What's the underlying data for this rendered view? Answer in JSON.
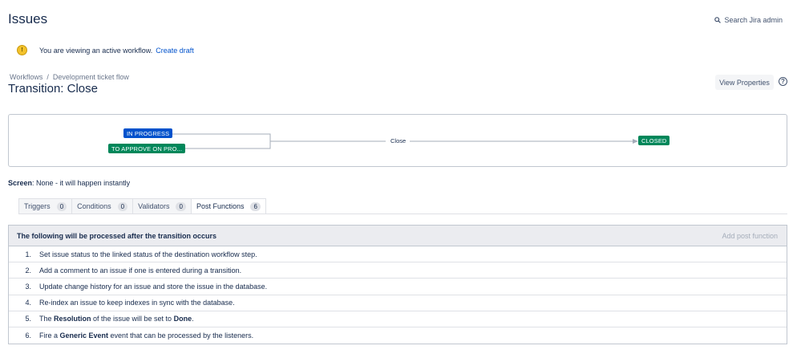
{
  "header": {
    "title": "Issues",
    "search_admin": "Search Jira admin"
  },
  "notice": {
    "text": "You are viewing an active workflow.",
    "link": "Create draft"
  },
  "breadcrumb": {
    "items": [
      "Workflows",
      "Development ticket flow"
    ],
    "separator": "/"
  },
  "transition": {
    "title": "Transition: Close",
    "view_properties": "View Properties"
  },
  "diagram": {
    "from_statuses": [
      "IN PROGRESS",
      "TO APPROVE ON PRO..."
    ],
    "transition_label": "Close",
    "to_status": "CLOSED",
    "colors": {
      "in_progress": "#0052cc",
      "done": "#00875a"
    }
  },
  "screen": {
    "label": "Screen",
    "value": ": None - it will happen instantly"
  },
  "tabs": [
    {
      "label": "Triggers",
      "count": "0"
    },
    {
      "label": "Conditions",
      "count": "0"
    },
    {
      "label": "Validators",
      "count": "0"
    },
    {
      "label": "Post Functions",
      "count": "6"
    }
  ],
  "post_functions": {
    "header": "The following will be processed after the transition occurs",
    "add_label": "Add post function",
    "items": [
      {
        "num": "1.",
        "pre": "Set issue status to the linked status of the destination workflow step.",
        "bold1": "",
        "mid": "",
        "bold2": "",
        "post": ""
      },
      {
        "num": "2.",
        "pre": "Add a comment to an issue if one is entered during a transition.",
        "bold1": "",
        "mid": "",
        "bold2": "",
        "post": ""
      },
      {
        "num": "3.",
        "pre": "Update change history for an issue and store the issue in the database.",
        "bold1": "",
        "mid": "",
        "bold2": "",
        "post": ""
      },
      {
        "num": "4.",
        "pre": "Re-index an issue to keep indexes in sync with the database.",
        "bold1": "",
        "mid": "",
        "bold2": "",
        "post": ""
      },
      {
        "num": "5.",
        "pre": "The ",
        "bold1": "Resolution",
        "mid": " of the issue will be set to ",
        "bold2": "Done",
        "post": "."
      },
      {
        "num": "6.",
        "pre": "Fire a ",
        "bold1": "Generic Event",
        "mid": " event that can be processed by the listeners.",
        "bold2": "",
        "post": ""
      }
    ]
  }
}
